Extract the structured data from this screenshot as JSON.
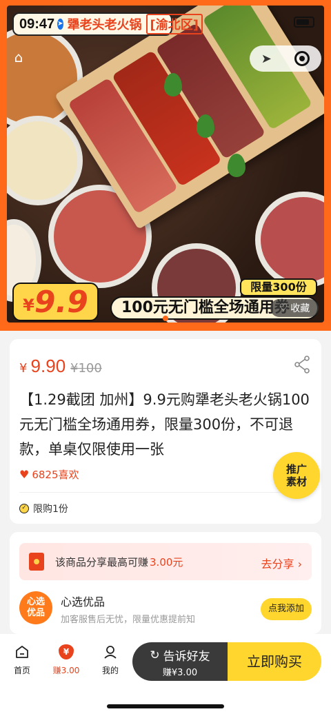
{
  "status": {
    "time": "09:47"
  },
  "hero": {
    "shop_name": "犟老头老火锅",
    "district": "[渝北区]",
    "price_currency": "¥",
    "price_value": "9.9",
    "limited": "限量300份",
    "banner": "100元无门槛全场通用券",
    "favorite_label": "收藏"
  },
  "product": {
    "currency": "¥",
    "price": "9.90",
    "original_price": "¥100",
    "title": "【1.29截团 加州】9.9元购犟老头老火锅100元无门槛全场通用券，限量300份，不可退款，单桌仅限使用一张",
    "likes": "6825喜欢",
    "limit": "限购1份",
    "promo_line1": "推广",
    "promo_line2": "素材"
  },
  "share": {
    "earn_text": "该商品分享最高可赚",
    "earn_amount": "3.00元",
    "go_share": "去分享",
    "shop_logo_line1": "心选",
    "shop_logo_line2": "优品",
    "shop_name": "心选优品",
    "shop_desc": "加客服售后无忧，限量优惠提前知",
    "add_button": "点我添加"
  },
  "bottom_nav": {
    "home": "首页",
    "earn": "赚3.00",
    "earn_icon_text": "¥",
    "mine": "我的",
    "tell_friends": "告诉好友",
    "tell_earn": "赚¥3.00",
    "buy_now": "立即购买"
  },
  "colors": {
    "accent": "#e8431d",
    "hero_bg": "#ff6a1a",
    "yellow": "#ffd62e"
  }
}
